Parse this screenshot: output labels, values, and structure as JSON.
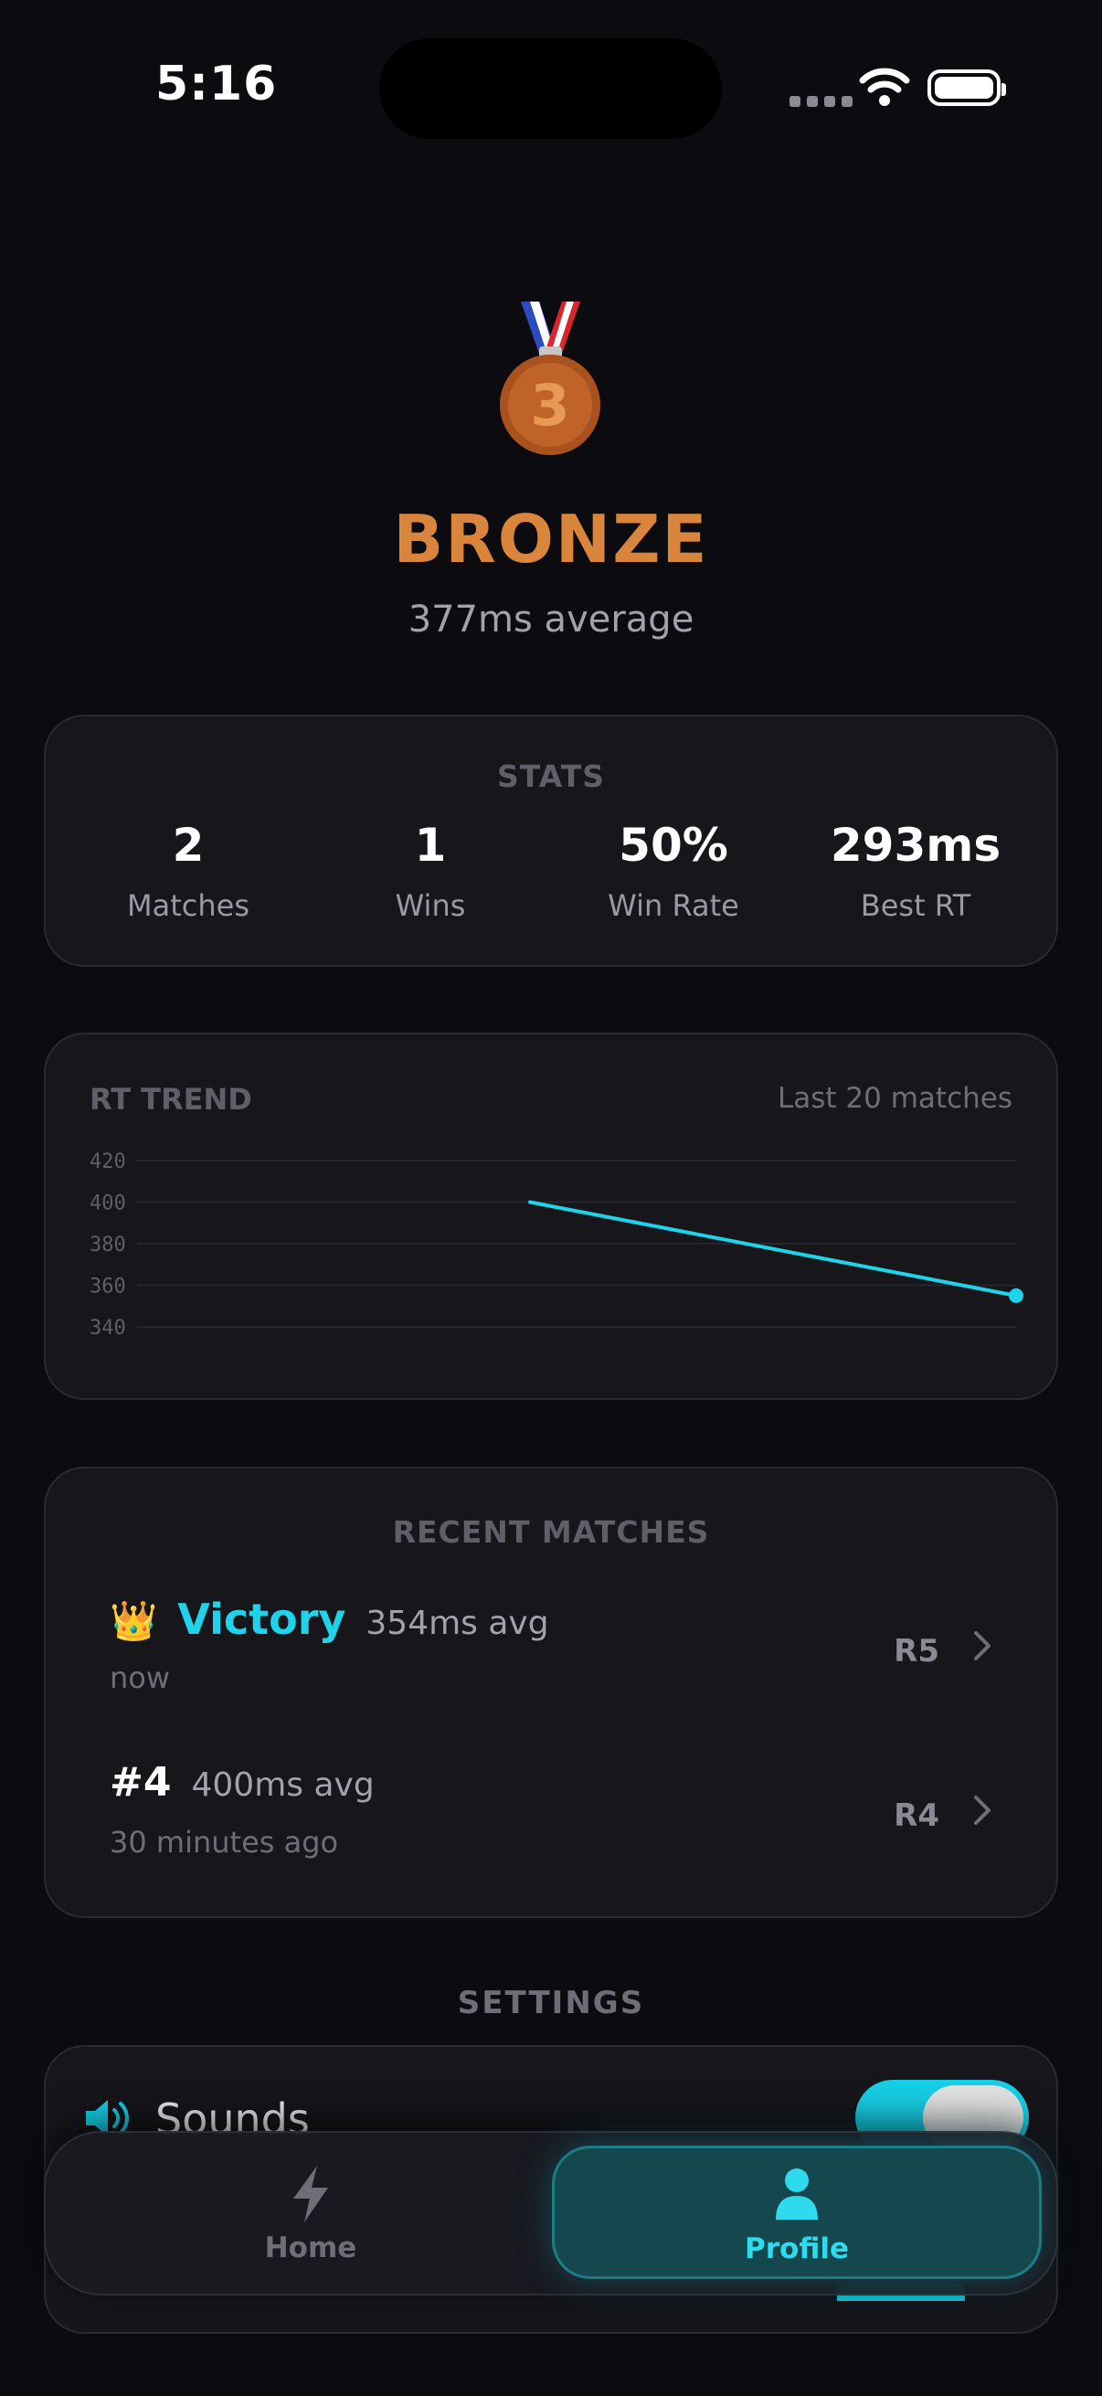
{
  "status_bar": {
    "time": "5:16"
  },
  "hero": {
    "medal_icon": "third-place-medal-icon",
    "medal_number": "3",
    "rank": "BRONZE",
    "average": "377ms average",
    "rank_color": "#d9853b"
  },
  "stats": {
    "title": "STATS",
    "items": [
      {
        "value": "2",
        "label": "Matches"
      },
      {
        "value": "1",
        "label": "Wins"
      },
      {
        "value": "50%",
        "label": "Win Rate"
      },
      {
        "value": "293ms",
        "label": "Best RT"
      }
    ]
  },
  "chart_data": {
    "type": "line",
    "title": "RT TREND",
    "subtitle": "Last 20 matches",
    "x": [
      1,
      2
    ],
    "series": [
      {
        "values": [
          400,
          355
        ]
      }
    ],
    "yticks": [
      "420",
      "400",
      "380",
      "360",
      "340"
    ],
    "ylim": [
      340,
      420
    ],
    "grid": true,
    "color": "#1fd3ea"
  },
  "recent_matches": {
    "title": "RECENT MATCHES",
    "items": [
      {
        "icon": "crown-icon",
        "result": "Victory",
        "avg": "354ms avg",
        "when": "now",
        "round": "R5"
      },
      {
        "result": "#4",
        "avg": "400ms avg",
        "when": "30 minutes ago",
        "round": "R4"
      }
    ]
  },
  "settings": {
    "title": "SETTINGS",
    "sounds_label": "Sounds",
    "sounds_on": true,
    "accent": "#17cfe6"
  },
  "tabbar": {
    "home_label": "Home",
    "profile_label": "Profile",
    "active": "Profile"
  }
}
